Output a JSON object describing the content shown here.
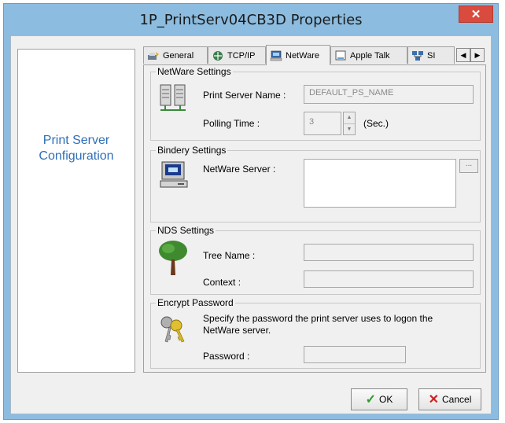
{
  "window": {
    "title": "1P_PrintServ04CB3D Properties"
  },
  "left_panel": {
    "title_line1": "Print Server",
    "title_line2": "Configuration"
  },
  "tabs": [
    {
      "label": "General",
      "icon": "general-icon"
    },
    {
      "label": "TCP/IP",
      "icon": "tcpip-icon"
    },
    {
      "label": "NetWare",
      "icon": "netware-icon",
      "active": true
    },
    {
      "label": "Apple Talk",
      "icon": "appletalk-icon"
    },
    {
      "label": "SI",
      "icon": "snmp-icon"
    }
  ],
  "netware_settings": {
    "legend": "NetWare Settings",
    "print_server_name_label": "Print Server Name :",
    "print_server_name_value": "DEFAULT_PS_NAME",
    "polling_time_label": "Polling Time :",
    "polling_time_value": "3",
    "polling_unit": "(Sec.)"
  },
  "bindery_settings": {
    "legend": "Bindery Settings",
    "netware_server_label": "NetWare Server :",
    "browse_label": "..."
  },
  "nds_settings": {
    "legend": "NDS Settings",
    "tree_name_label": "Tree Name :",
    "context_label": "Context :"
  },
  "encrypt_password": {
    "legend": "Encrypt Password",
    "description": "Specify the password the print server uses to logon the NetWare server.",
    "password_label": "Password :"
  },
  "buttons": {
    "ok": "OK",
    "cancel": "Cancel"
  }
}
